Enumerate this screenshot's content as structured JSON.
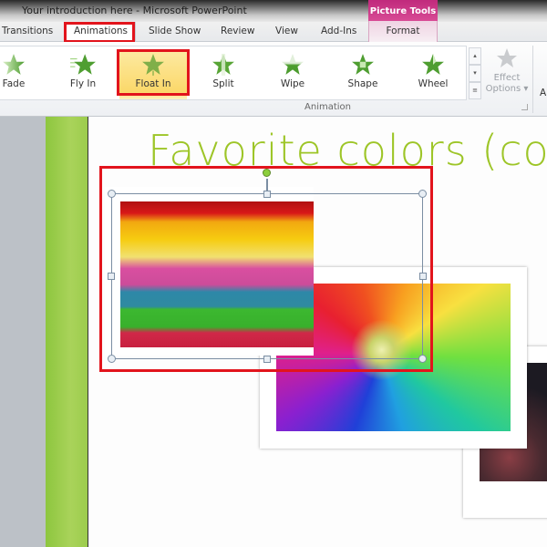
{
  "window": {
    "title": "Your introduction here  -  Microsoft PowerPoint"
  },
  "context_tab": {
    "group": "Picture Tools",
    "tab": "Format",
    "color": "#c8307f"
  },
  "tabs": [
    {
      "label": "Transitions"
    },
    {
      "label": "Animations",
      "active": true
    },
    {
      "label": "Slide Show"
    },
    {
      "label": "Review"
    },
    {
      "label": "View"
    },
    {
      "label": "Add-Ins"
    }
  ],
  "ribbon": {
    "animations": [
      {
        "label": "Fade",
        "icon": "fade-star-icon"
      },
      {
        "label": "Fly In",
        "icon": "fly-in-star-icon"
      },
      {
        "label": "Float In",
        "icon": "float-in-star-icon",
        "selected": true
      },
      {
        "label": "Split",
        "icon": "split-star-icon"
      },
      {
        "label": "Wipe",
        "icon": "wipe-star-icon"
      },
      {
        "label": "Shape",
        "icon": "shape-star-icon"
      },
      {
        "label": "Wheel",
        "icon": "wheel-star-icon"
      }
    ],
    "effect_options": {
      "line1": "Effect",
      "line2": "Options ▾"
    },
    "group_label": "Animation",
    "next_group_initial": "A",
    "scroll_up": "▴",
    "scroll_down": "▾",
    "scroll_more": "≡"
  },
  "slide": {
    "title": "Favorite colors (co",
    "title_color": "#9dc527",
    "images": [
      {
        "name": "rainbow-stripes-picture",
        "selected": true
      },
      {
        "name": "rainbow-flower-picture"
      },
      {
        "name": "crayons-picture"
      }
    ]
  },
  "highlight_color": "#e2141c"
}
